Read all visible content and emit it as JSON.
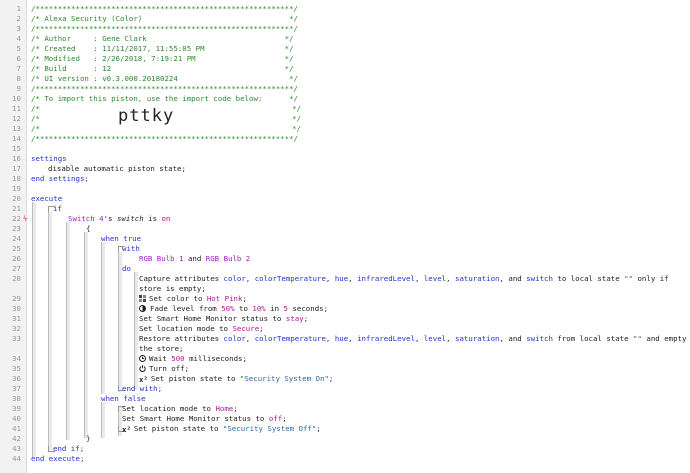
{
  "header_comment": {
    "border": "/**********************************************************/",
    "title_line": "/* Alexa Security (Color)                                 */",
    "author_line": "/* Author     : Gene Clark                               */",
    "created_line": "/* Created    : 11/11/2017, 11:55:05 PM                  */",
    "modified_line": "/* Modified   : 2/26/2018, 7:19:21 PM                    */",
    "build_line": "/* Build      : 12                                       */",
    "ui_line": "/* UI version : v0.3.000.20180224                         */",
    "import_line": "/* To import this piston, use the import code below:      */",
    "blank_open": "/*",
    "blank_close": "*/",
    "import_code": "pttky"
  },
  "settings": {
    "open": "settings",
    "item": "disable automatic piston state;",
    "close": "end settings;"
  },
  "execute": {
    "open": "execute",
    "if_kw": "if",
    "condition": {
      "device": "Switch 4",
      "possessive": "'s",
      "attribute": "switch",
      "operator": "is",
      "value": "on"
    },
    "open_brace": "{",
    "close_brace": "}",
    "when_true": {
      "label_when": "when",
      "label_value": "true",
      "with_kw": "with",
      "device_a": "RGB Bulb 1",
      "and_kw": "and",
      "device_b": "RGB Bulb 2",
      "do_kw": "do",
      "capture": {
        "prefix": "Capture attributes",
        "attrs": [
          "color",
          "colorTemperature",
          "hue",
          "infraredLevel",
          "level",
          "saturation"
        ],
        "and_word": "and",
        "last_attr": "switch",
        "mid": "to local state",
        "state": "\"\"",
        "tail": "only if",
        "wrap": "store is empty;"
      },
      "set_color": {
        "prefix": "Set color to",
        "value": "Hot Pink",
        "end": ";"
      },
      "fade": {
        "prefix": "Fade level from",
        "from": "50%",
        "to_kw": "to",
        "to": "10%",
        "in_kw": "in",
        "dur": "5",
        "unit": "seconds;"
      },
      "shm": {
        "prefix": "Set Smart Home Monitor status to",
        "value": "stay",
        "end": ";"
      },
      "location": {
        "prefix": "Set location mode to",
        "value": "Secure",
        "end": ";"
      },
      "restore": {
        "prefix": "Restore attributes",
        "attrs": [
          "color",
          "colorTemperature",
          "hue",
          "infraredLevel",
          "level",
          "saturation"
        ],
        "and_word": "and",
        "last_attr": "switch",
        "mid": "from local state",
        "state": "\"\"",
        "tail": "and empty",
        "wrap": "the store;"
      },
      "wait": {
        "prefix": "Wait",
        "value": "500",
        "unit": "milliseconds;"
      },
      "turn_off": "Turn off;",
      "piston_state": {
        "prefix": "Set piston state to",
        "value": "\"Security System On\"",
        "end": ";"
      },
      "end_with": "end with;"
    },
    "when_false": {
      "label_when": "when",
      "label_value": "false",
      "location": {
        "prefix": "Set location mode to",
        "value": "Home",
        "end": ";"
      },
      "shm": {
        "prefix": "Set Smart Home Monitor status to",
        "value": "off",
        "end": ";"
      },
      "piston_state": {
        "prefix": "Set piston state to",
        "value": "\"Security System Off\"",
        "end": ";"
      }
    },
    "end_if": "end if;",
    "close": "end execute;"
  },
  "line_numbers": [
    "1",
    "2",
    "3",
    "4",
    "5",
    "6",
    "7",
    "8",
    "9",
    "10",
    "11",
    "12",
    "13",
    "14",
    "15",
    "16",
    "17",
    "18",
    "19",
    "20",
    "21",
    "22",
    "23",
    "24",
    "25",
    "26",
    "27",
    "28",
    "29",
    "30",
    "31",
    "32",
    "33",
    "34",
    "35",
    "36",
    "37",
    "38",
    "39",
    "40",
    "41",
    "42",
    "43",
    "44"
  ],
  "colors": {
    "keyword": "#2233cc",
    "device": "#a020c8",
    "literal": "#b0159a",
    "comment": "#2c8a2c",
    "trigger_marker": "#dd3333"
  },
  "icons": {
    "trigger_marker": "lightning-icon",
    "set_color": "palette-icon",
    "fade": "dim-icon",
    "wait": "clock-icon",
    "turn_off": "power-icon",
    "piston_state": "variable-icon"
  }
}
